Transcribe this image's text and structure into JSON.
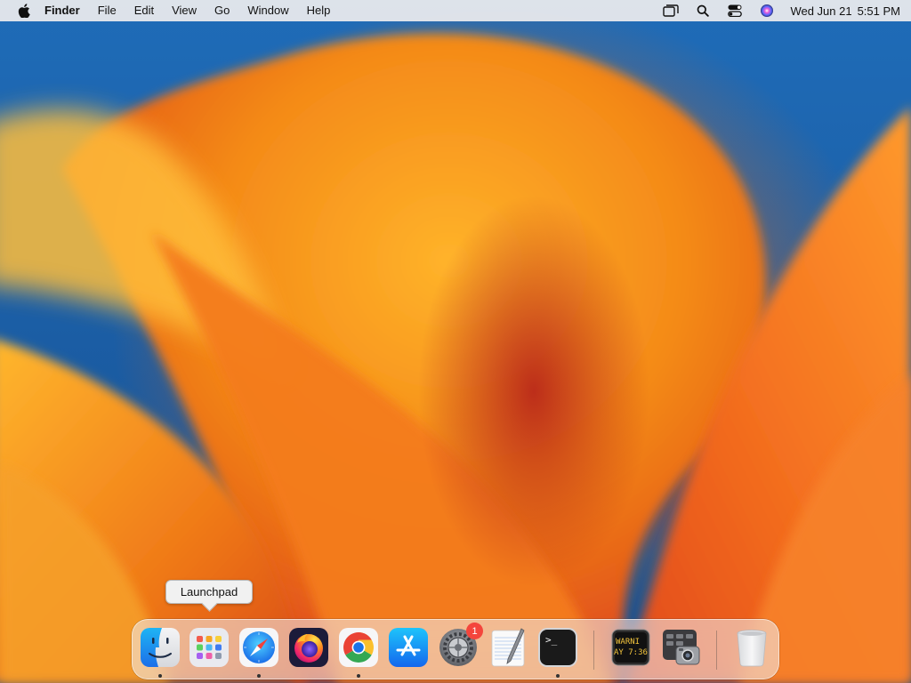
{
  "menubar": {
    "app_name": "Finder",
    "menus": [
      "File",
      "Edit",
      "View",
      "Go",
      "Window",
      "Help"
    ],
    "date": "Wed Jun 21",
    "time": "5:51 PM",
    "status_icons": [
      "screen-mirroring-icon",
      "spotlight-search-icon",
      "control-center-icon",
      "siri-icon"
    ]
  },
  "tooltip": {
    "text": "Launchpad"
  },
  "dock": {
    "apps": [
      {
        "name": "Finder",
        "icon": "finder-icon",
        "running": true
      },
      {
        "name": "Launchpad",
        "icon": "launchpad-icon",
        "running": false
      },
      {
        "name": "Safari",
        "icon": "safari-icon",
        "running": true
      },
      {
        "name": "Firefox",
        "icon": "firefox-icon",
        "running": false
      },
      {
        "name": "Google Chrome",
        "icon": "chrome-icon",
        "running": true
      },
      {
        "name": "App Store",
        "icon": "app-store-icon",
        "running": false
      },
      {
        "name": "System Settings",
        "icon": "system-settings-icon",
        "running": false,
        "badge": "1"
      },
      {
        "name": "TextEdit",
        "icon": "textedit-icon",
        "running": false
      },
      {
        "name": "Terminal",
        "icon": "terminal-icon",
        "running": true
      },
      {
        "name": "Console",
        "icon": "console-icon",
        "running": false,
        "icon_text": [
          "WARNI",
          "AY 7:36"
        ]
      },
      {
        "name": "Screenshot",
        "icon": "screenshot-icon",
        "running": false
      },
      {
        "name": "Trash",
        "icon": "trash-icon",
        "running": false
      }
    ],
    "terminal_prompt": ">_"
  },
  "colors": {
    "wallpaper_orange": "#f08a1c",
    "wallpaper_red": "#b7281a",
    "wallpaper_blue": "#1f6cb8",
    "badge_red": "#f4453c"
  }
}
